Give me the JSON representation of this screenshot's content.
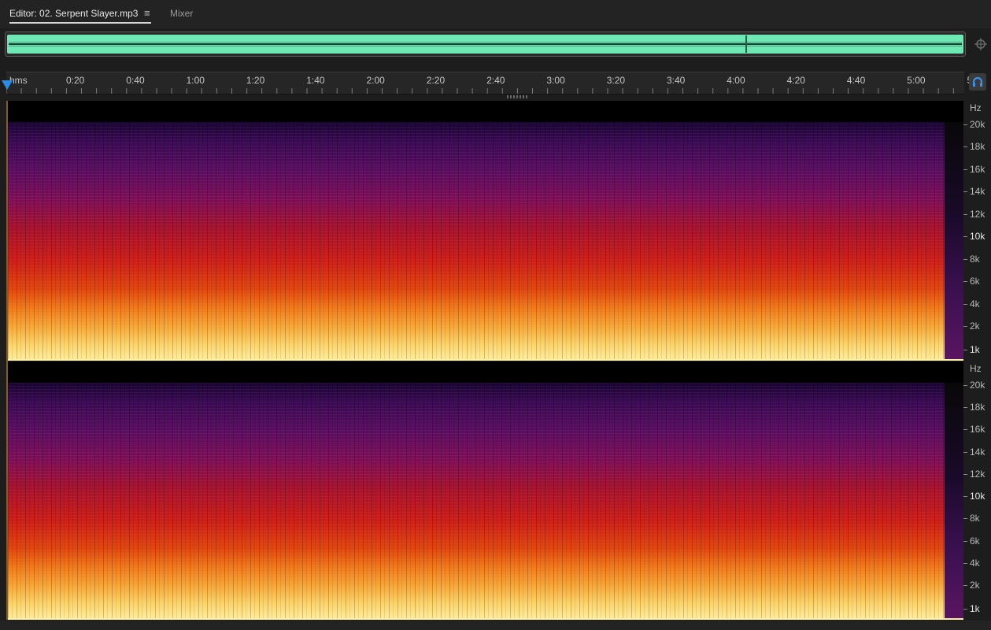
{
  "tabs": {
    "editor_label": "Editor: 02. Serpent Slayer.mp3",
    "menu_glyph": "≡",
    "mixer_label": "Mixer"
  },
  "ruler": {
    "labels": [
      "hms",
      "0:20",
      "0:40",
      "1:00",
      "1:20",
      "1:40",
      "2:00",
      "2:20",
      "2:40",
      "3:00",
      "3:20",
      "3:40",
      "4:00",
      "4:20",
      "4:40",
      "5:00",
      "5"
    ]
  },
  "frequency_scale": {
    "unit": "Hz",
    "labels": [
      "20k",
      "18k",
      "16k",
      "14k",
      "12k",
      "10k",
      "8k",
      "6k",
      "4k",
      "2k",
      "1k"
    ],
    "emphasized": [
      "10k",
      "1k"
    ]
  },
  "colors": {
    "overview_waveform": "#6ee8b4",
    "playhead": "#2b8ce5",
    "snap_icon": "#3a8fe8"
  },
  "icons": {
    "zoom": "zoom-magnifier-icon",
    "tab_menu": "hamburger-menu-icon",
    "snap": "headphones-snap-icon",
    "playhead": "playhead-marker-icon"
  }
}
